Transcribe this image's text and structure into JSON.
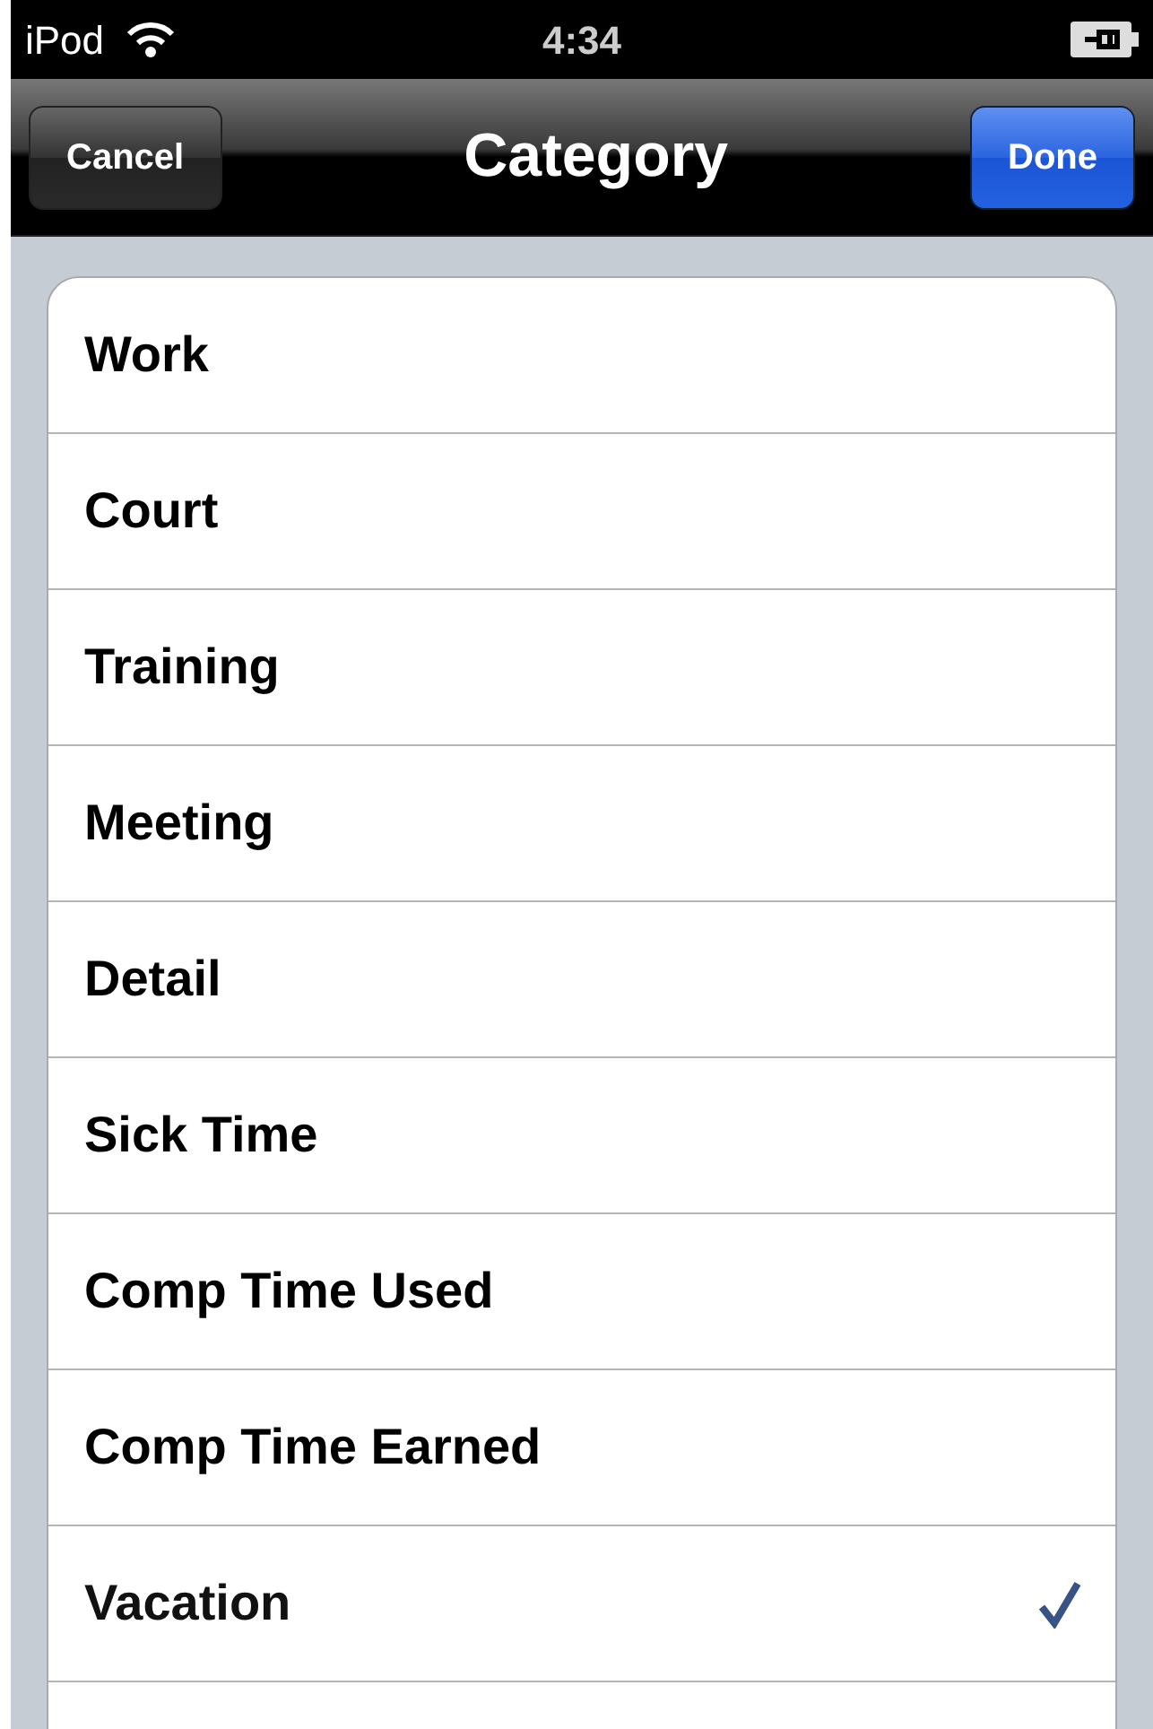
{
  "status_bar": {
    "carrier": "iPod",
    "time": "4:34"
  },
  "nav_bar": {
    "title": "Category",
    "left_button": "Cancel",
    "right_button": "Done"
  },
  "categories": [
    {
      "label": "Work",
      "selected": false
    },
    {
      "label": "Court",
      "selected": false
    },
    {
      "label": "Training",
      "selected": false
    },
    {
      "label": "Meeting",
      "selected": false
    },
    {
      "label": "Detail",
      "selected": false
    },
    {
      "label": "Sick Time",
      "selected": false
    },
    {
      "label": "Comp Time Used",
      "selected": false
    },
    {
      "label": "Comp Time Earned",
      "selected": false
    },
    {
      "label": "Vacation",
      "selected": true
    }
  ]
}
